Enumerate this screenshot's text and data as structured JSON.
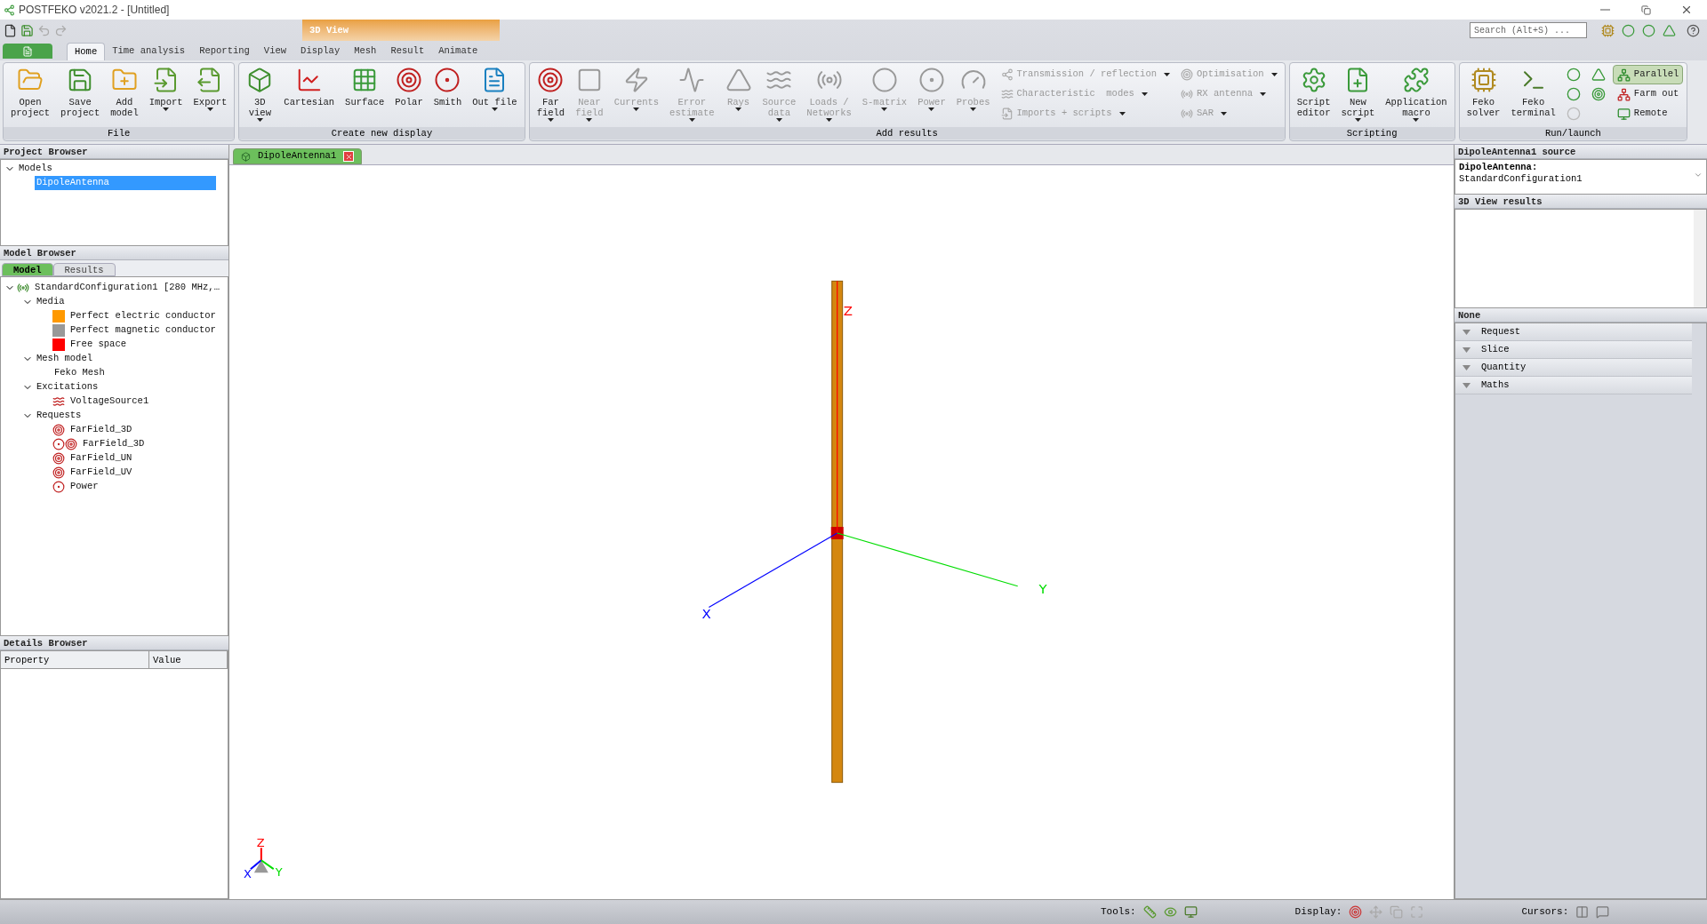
{
  "window": {
    "title": "POSTFEKO v2021.2 - [Untitled]",
    "search": {
      "placeholder": "Search (Alt+S) ..."
    }
  },
  "context_tab": {
    "label": "3D View"
  },
  "tabs": [
    {
      "label": "Home",
      "selected": true
    },
    {
      "label": "Time analysis",
      "selected": false
    },
    {
      "label": "Reporting",
      "selected": false
    },
    {
      "label": "View",
      "selected": false
    },
    {
      "label": "Display",
      "selected": false
    },
    {
      "label": "Mesh",
      "selected": false
    },
    {
      "label": "Result",
      "selected": false
    },
    {
      "label": "Animate",
      "selected": false
    }
  ],
  "ribbon": {
    "groups": [
      {
        "title": "File",
        "items": [
          {
            "kind": "large",
            "label": "Open\nproject",
            "dropdown": false,
            "disabled": false
          },
          {
            "kind": "large",
            "label": "Save\nproject",
            "dropdown": false,
            "disabled": false
          },
          {
            "kind": "large",
            "label": "Add\nmodel",
            "dropdown": false,
            "disabled": false
          },
          {
            "kind": "large",
            "label": "Import",
            "dropdown": true,
            "disabled": false
          },
          {
            "kind": "large",
            "label": "Export",
            "dropdown": true,
            "disabled": false
          }
        ]
      },
      {
        "title": "Create new display",
        "items": [
          {
            "kind": "large",
            "label": "3D\nview",
            "dropdown": true,
            "disabled": false
          },
          {
            "kind": "large",
            "label": "Cartesian",
            "dropdown": false,
            "disabled": false
          },
          {
            "kind": "large",
            "label": "Surface",
            "dropdown": false,
            "disabled": false
          },
          {
            "kind": "large",
            "label": "Polar",
            "dropdown": false,
            "disabled": false
          },
          {
            "kind": "large",
            "label": "Smith",
            "dropdown": false,
            "disabled": false
          },
          {
            "kind": "large",
            "label": "Out file",
            "dropdown": true,
            "disabled": false
          }
        ]
      },
      {
        "title": "Add results",
        "items": [
          {
            "kind": "large",
            "label": "Far\nfield",
            "dropdown": true,
            "disabled": false
          },
          {
            "kind": "large",
            "label": "Near\nfield",
            "dropdown": true,
            "disabled": true
          },
          {
            "kind": "large",
            "label": "Currents",
            "dropdown": true,
            "disabled": true
          },
          {
            "kind": "large",
            "label": "Error\nestimate",
            "dropdown": true,
            "disabled": true
          },
          {
            "kind": "large",
            "label": "Rays",
            "dropdown": true,
            "disabled": true
          },
          {
            "kind": "large",
            "label": "Source\ndata",
            "dropdown": true,
            "disabled": true
          },
          {
            "kind": "large",
            "label": "Loads /\nNetworks",
            "dropdown": true,
            "disabled": true
          },
          {
            "kind": "large",
            "label": "S-matrix",
            "dropdown": true,
            "disabled": true
          },
          {
            "kind": "large",
            "label": "Power",
            "dropdown": true,
            "disabled": true
          },
          {
            "kind": "large",
            "label": "Probes",
            "dropdown": true,
            "disabled": true
          },
          {
            "kind": "small",
            "label": "Transmission / reflection",
            "dropdown": true,
            "disabled": true
          },
          {
            "kind": "small",
            "label": "Characteristic  modes",
            "dropdown": true,
            "disabled": true
          },
          {
            "kind": "small",
            "label": "Imports + scripts",
            "dropdown": true,
            "disabled": true
          },
          {
            "kind": "small",
            "label": "Optimisation",
            "dropdown": true,
            "disabled": true
          },
          {
            "kind": "small",
            "label": "RX antenna",
            "dropdown": true,
            "disabled": true
          },
          {
            "kind": "small",
            "label": "SAR",
            "dropdown": true,
            "disabled": true
          }
        ]
      },
      {
        "title": "Scripting",
        "items": [
          {
            "kind": "large",
            "label": "Script\neditor",
            "dropdown": false,
            "disabled": false
          },
          {
            "kind": "large",
            "label": "New\nscript",
            "dropdown": true,
            "disabled": false
          },
          {
            "kind": "large",
            "label": "Application\nmacro",
            "dropdown": true,
            "disabled": false
          }
        ]
      },
      {
        "title": "Run/launch",
        "items": [
          {
            "kind": "large",
            "label": "Feko\nsolver",
            "dropdown": false,
            "disabled": false
          },
          {
            "kind": "large",
            "label": "Feko\nterminal",
            "dropdown": false,
            "disabled": false
          },
          {
            "kind": "icon",
            "disabled": false
          },
          {
            "kind": "icon",
            "disabled": false
          },
          {
            "kind": "icon",
            "disabled": true
          },
          {
            "kind": "icon",
            "disabled": false
          },
          {
            "kind": "icon",
            "disabled": false
          },
          {
            "kind": "toggle",
            "label": "Parallel",
            "selected": true
          },
          {
            "kind": "toggle",
            "label": "Farm out",
            "selected": false
          },
          {
            "kind": "toggle",
            "label": "Remote",
            "selected": false
          }
        ]
      }
    ]
  },
  "project_browser": {
    "title": "Project Browser",
    "tree": [
      {
        "label": "Models",
        "expanded": true,
        "selected": false,
        "children": [
          {
            "label": "DipoleAntenna",
            "selected": true
          }
        ]
      }
    ]
  },
  "model_browser": {
    "title": "Model Browser",
    "tabs": [
      {
        "label": "Model",
        "selected": true
      },
      {
        "label": "Results",
        "selected": false
      }
    ],
    "tree": [
      {
        "label": "StandardConfiguration1 [280 MHz,…",
        "kind": "config",
        "expanded": true,
        "selected": false,
        "children": [
          {
            "label": "Media",
            "expanded": true,
            "selected": false,
            "children": [
              {
                "label": "Perfect electric conductor",
                "kind": "medium",
                "color": "#ff9900",
                "selected": false
              },
              {
                "label": "Perfect magnetic conductor",
                "kind": "medium",
                "color": "#999999",
                "selected": false
              },
              {
                "label": "Free space",
                "kind": "medium",
                "color": "#ff0000",
                "selected": false
              }
            ]
          },
          {
            "label": "Mesh model",
            "expanded": true,
            "selected": false,
            "children": [
              {
                "label": "Feko Mesh",
                "selected": false
              }
            ]
          },
          {
            "label": "Excitations",
            "expanded": true,
            "selected": false,
            "children": [
              {
                "label": "VoltageSource1",
                "kind": "source",
                "selected": false
              }
            ]
          },
          {
            "label": "Requests",
            "expanded": true,
            "selected": false,
            "children": [
              {
                "label": "FarField_3D",
                "kind": "farfield",
                "selected": false
              },
              {
                "label": "FarField_3D",
                "kind": "power_farfield",
                "selected": false
              },
              {
                "label": "FarField_UN",
                "kind": "farfield",
                "selected": false
              },
              {
                "label": "FarField_UV",
                "kind": "farfield",
                "selected": false
              },
              {
                "label": "Power",
                "kind": "power",
                "selected": false
              }
            ]
          }
        ]
      }
    ]
  },
  "details_browser": {
    "title": "Details Browser",
    "columns": [
      "Property",
      "Value"
    ]
  },
  "document_tab": {
    "label": "DipoleAntenna1"
  },
  "viewport": {
    "axes": [
      {
        "label": "Z",
        "color": "#ff0000"
      },
      {
        "label": "X",
        "color": "#0000ff"
      },
      {
        "label": "Y",
        "color": "#00dd00"
      }
    ],
    "triad": [
      {
        "label": "Z",
        "color": "#ff0000"
      },
      {
        "label": "X",
        "color": "#0000ff"
      },
      {
        "label": "Y",
        "color": "#00dd00"
      }
    ]
  },
  "right_panel": {
    "source_title": "DipoleAntenna1 source",
    "source_model": "DipoleAntenna:",
    "source_config": "StandardConfiguration1",
    "results_title": "3D View results",
    "section_title": "None",
    "sections": [
      {
        "label": "Request",
        "expanded": false
      },
      {
        "label": "Slice",
        "expanded": false
      },
      {
        "label": "Quantity",
        "expanded": false
      },
      {
        "label": "Maths",
        "expanded": false
      }
    ]
  },
  "status_bar": {
    "tools_label": "Tools:",
    "display_label": "Display:",
    "cursors_label": "Cursors:"
  }
}
